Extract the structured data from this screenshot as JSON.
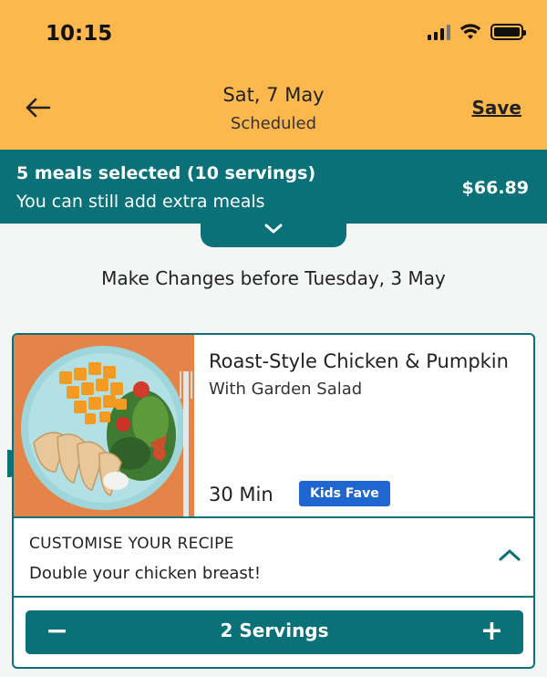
{
  "status_bar": {
    "time": "10:15",
    "icons": [
      "signal-icon",
      "wifi-icon",
      "battery-icon"
    ]
  },
  "header": {
    "back_icon": "arrow-left-icon",
    "date": "Sat, 7 May",
    "status": "Scheduled",
    "save_label": "Save",
    "background": "#fcb84d"
  },
  "summary": {
    "title": "5 meals selected (10 servings)",
    "subtitle": "You can still add extra meals",
    "price": "$66.89",
    "expand_icon": "chevron-down-icon",
    "background": "#0a7179"
  },
  "deadline_text": "Make Changes before Tuesday, 3 May",
  "recipe": {
    "image": "chicken-pumpkin-salad-plate",
    "title": "Roast-Style Chicken & Pumpkin",
    "subtitle": "With Garden Salad",
    "time": "30 Min",
    "badge": "Kids Fave",
    "badge_color": "#1f66d1",
    "customise": {
      "title": "CUSTOMISE YOUR RECIPE",
      "subtitle": "Double your chicken breast!",
      "icon": "chevron-up-icon"
    },
    "servings": {
      "minus_label": "−",
      "label": "2 Servings",
      "plus_label": "+"
    }
  }
}
